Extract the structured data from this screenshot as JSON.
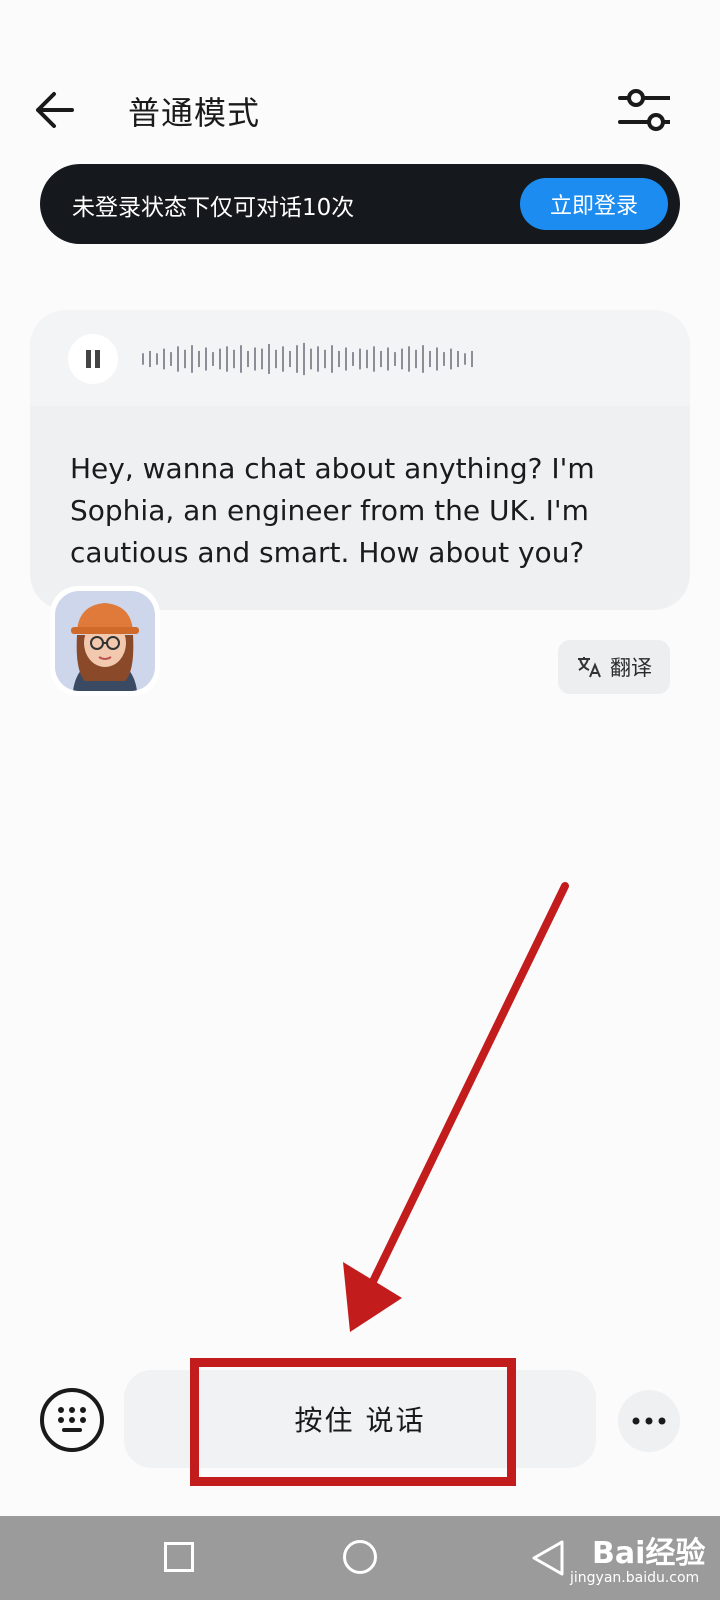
{
  "header": {
    "title": "普通模式",
    "back_icon": "arrow-left-icon",
    "settings_icon": "sliders-icon"
  },
  "login_banner": {
    "text": "未登录状态下仅可对话10次",
    "button_label": "立即登录",
    "background": "#15181d",
    "button_color": "#1c8cf0"
  },
  "message": {
    "text": "Hey, wanna chat about anything? I'm Sophia, an engineer from the UK. I'm cautious and smart. How about you?",
    "audio_state": "playing",
    "translate_label": "翻译",
    "translate_icon": "translate-icon"
  },
  "input_bar": {
    "hold_to_talk_label": "按住 说话",
    "keyboard_icon": "keyboard-icon",
    "more_icon": "more-dots-icon"
  },
  "annotation": {
    "color": "#c21c1c"
  },
  "nav_bar": {
    "watermark_brand": "Bai经验",
    "watermark_url": "jingyan.baidu.com"
  }
}
